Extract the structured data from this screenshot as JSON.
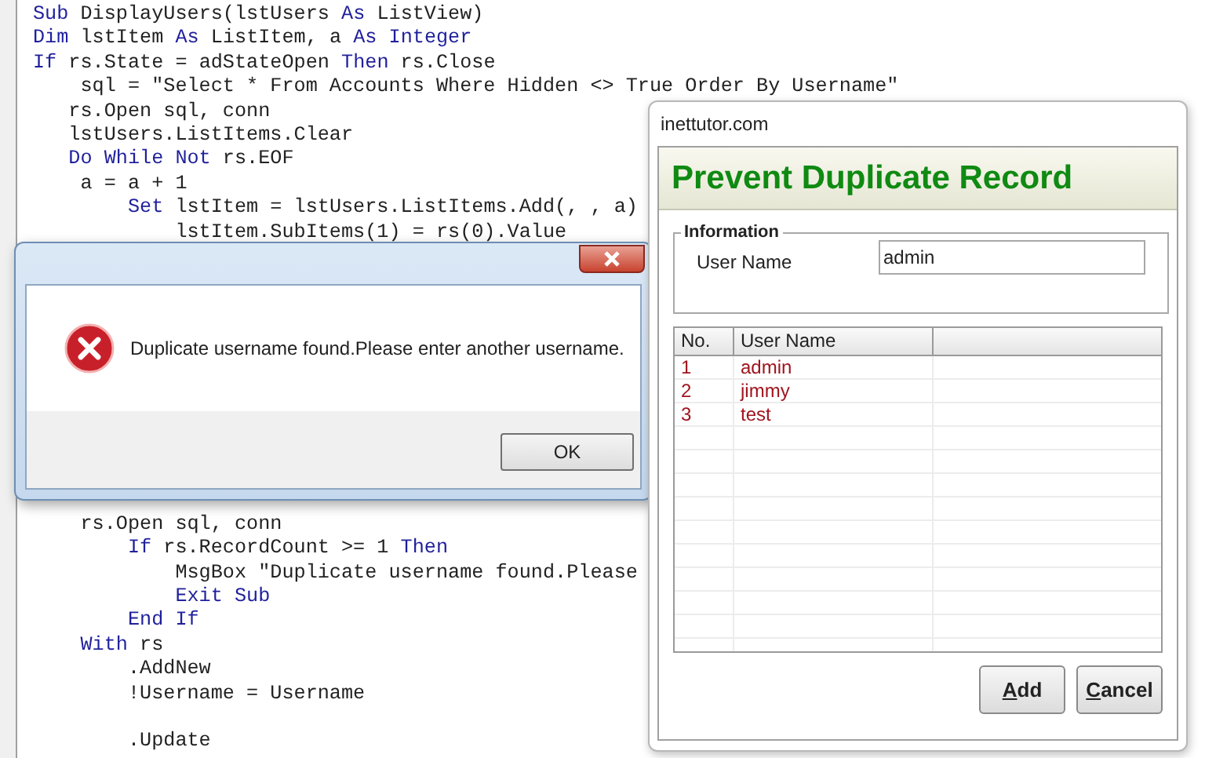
{
  "editor": {
    "lines_above_dialog": [
      {
        "segments": [
          {
            "kind": "keyword",
            "text": "Sub"
          },
          {
            "kind": "code",
            "text": " DisplayUsers(lstUsers "
          },
          {
            "kind": "keyword",
            "text": "As"
          },
          {
            "kind": "code",
            "text": " ListView)"
          }
        ]
      },
      {
        "segments": [
          {
            "kind": "keyword",
            "text": "Dim"
          },
          {
            "kind": "code",
            "text": " lstItem "
          },
          {
            "kind": "keyword",
            "text": "As"
          },
          {
            "kind": "code",
            "text": " ListItem, a "
          },
          {
            "kind": "keyword",
            "text": "As Integer"
          }
        ]
      },
      {
        "segments": [
          {
            "kind": "keyword",
            "text": "If"
          },
          {
            "kind": "code",
            "text": " rs.State = adStateOpen "
          },
          {
            "kind": "keyword",
            "text": "Then"
          },
          {
            "kind": "code",
            "text": " rs.Close"
          }
        ]
      },
      {
        "segments": [
          {
            "kind": "code",
            "text": "    sql = \"Select * From Accounts Where Hidden <> True Order By Username\""
          }
        ]
      },
      {
        "segments": [
          {
            "kind": "code",
            "text": "   rs.Open sql, conn"
          }
        ]
      },
      {
        "segments": [
          {
            "kind": "code",
            "text": "   lstUsers.ListItems.Clear"
          }
        ]
      },
      {
        "segments": [
          {
            "kind": "keyword",
            "text": "   Do While Not"
          },
          {
            "kind": "code",
            "text": " rs.EOF"
          }
        ]
      },
      {
        "segments": [
          {
            "kind": "code",
            "text": "    a = a + 1"
          }
        ]
      },
      {
        "segments": [
          {
            "kind": "keyword",
            "text": "        Set"
          },
          {
            "kind": "code",
            "text": " lstItem = lstUsers.ListItems.Add(, , a)"
          }
        ]
      },
      {
        "segments": [
          {
            "kind": "code",
            "text": "            lstItem.SubItems(1) = rs(0).Value"
          }
        ]
      }
    ],
    "lines_below_dialog": [
      {
        "segments": [
          {
            "kind": "code",
            "text": "    rs.Open sql, conn"
          }
        ]
      },
      {
        "segments": [
          {
            "kind": "keyword",
            "text": "        If"
          },
          {
            "kind": "code",
            "text": " rs.RecordCount >= 1 "
          },
          {
            "kind": "keyword",
            "text": "Then"
          }
        ]
      },
      {
        "segments": [
          {
            "kind": "code",
            "text": "            MsgBox \"Duplicate username found.Please"
          }
        ]
      },
      {
        "segments": [
          {
            "kind": "keyword",
            "text": "            Exit Sub"
          }
        ]
      },
      {
        "segments": [
          {
            "kind": "keyword",
            "text": "        End If"
          }
        ]
      },
      {
        "segments": [
          {
            "kind": "keyword",
            "text": "    With"
          },
          {
            "kind": "code",
            "text": " rs"
          }
        ]
      },
      {
        "segments": [
          {
            "kind": "code",
            "text": "        .AddNew"
          }
        ]
      },
      {
        "segments": [
          {
            "kind": "code",
            "text": "        !Username = Username"
          }
        ]
      },
      {
        "segments": [
          {
            "kind": "code",
            "text": "        .Update"
          }
        ]
      }
    ]
  },
  "message_box": {
    "message": "Duplicate username found.Please enter another username.",
    "button": "OK"
  },
  "form_window": {
    "title": "inettutor.com",
    "header": "Prevent Duplicate Record",
    "group": {
      "title": "Information",
      "label": "User Name",
      "value": "admin"
    },
    "list": {
      "columns": [
        "No.",
        "User Name"
      ],
      "rows": [
        {
          "cells": [
            "1",
            "admin"
          ]
        },
        {
          "cells": [
            "2",
            "jimmy"
          ]
        },
        {
          "cells": [
            "3",
            "test"
          ]
        }
      ]
    },
    "buttons": [
      {
        "label": "Add",
        "accelerator": true
      },
      {
        "label": "Cancel",
        "accelerator": true
      }
    ]
  }
}
